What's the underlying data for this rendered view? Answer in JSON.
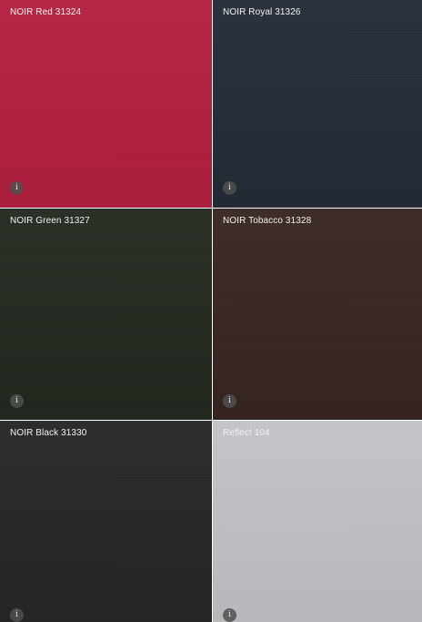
{
  "swatches": [
    {
      "name": "NOIR Red 31324",
      "color": "#b51f3f",
      "info_icon": "i"
    },
    {
      "name": "NOIR Royal 31326",
      "color": "#232b36",
      "info_icon": "i"
    },
    {
      "name": "NOIR Green 31327",
      "color": "#22291f",
      "info_icon": "i"
    },
    {
      "name": "NOIR Tobacco 31328",
      "color": "#372521",
      "info_icon": "i"
    },
    {
      "name": "NOIR Black 31330",
      "color": "#262626",
      "info_icon": "i"
    },
    {
      "name": "Reflect 104",
      "color": "#c4c4c8",
      "info_icon": "i"
    }
  ]
}
